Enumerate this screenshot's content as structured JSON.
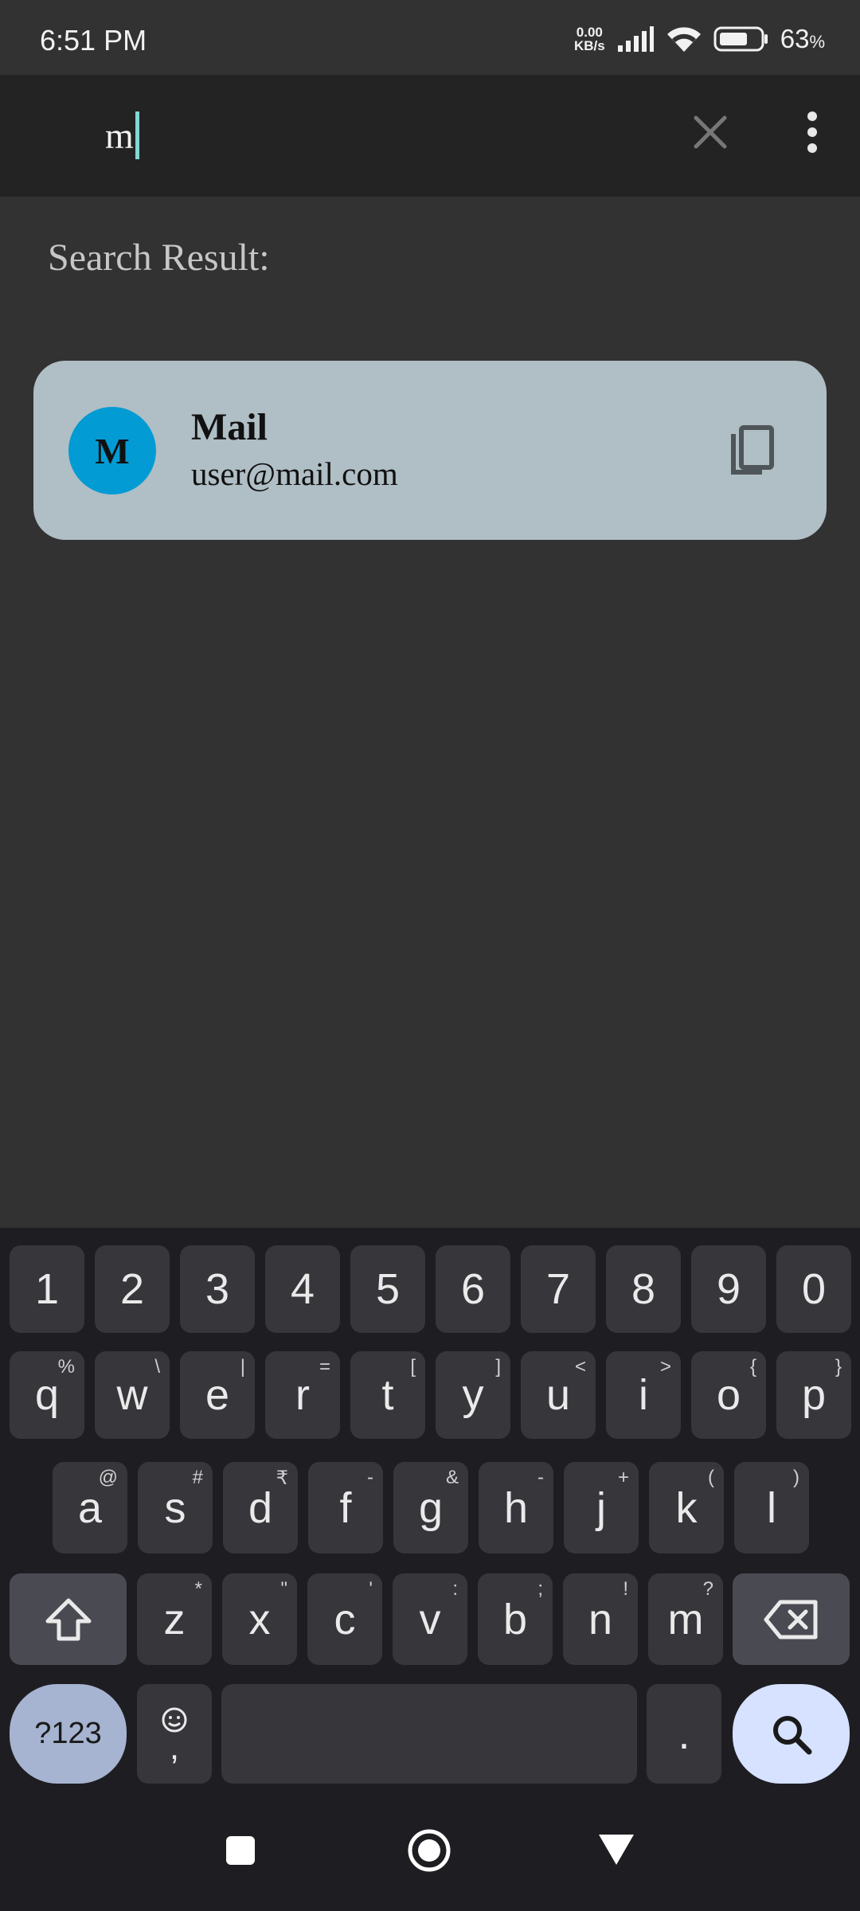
{
  "status_bar": {
    "time": "6:51 PM",
    "net_speed_value": "0.00",
    "net_speed_unit": "KB/s",
    "battery_percent": "63",
    "battery_unit": "%"
  },
  "search": {
    "query": "m"
  },
  "results": {
    "heading": "Search Result:",
    "items": [
      {
        "avatar_letter": "M",
        "title": "Mail",
        "subtitle": "user@mail.com",
        "avatar_color": "#039bd3"
      }
    ]
  },
  "keyboard": {
    "row1": [
      "1",
      "2",
      "3",
      "4",
      "5",
      "6",
      "7",
      "8",
      "9",
      "0"
    ],
    "row2": [
      {
        "k": "q",
        "s": "%"
      },
      {
        "k": "w",
        "s": "\\"
      },
      {
        "k": "e",
        "s": "|"
      },
      {
        "k": "r",
        "s": "="
      },
      {
        "k": "t",
        "s": "["
      },
      {
        "k": "y",
        "s": "]"
      },
      {
        "k": "u",
        "s": "<"
      },
      {
        "k": "i",
        "s": ">"
      },
      {
        "k": "o",
        "s": "{"
      },
      {
        "k": "p",
        "s": "}"
      }
    ],
    "row3": [
      {
        "k": "a",
        "s": "@"
      },
      {
        "k": "s",
        "s": "#"
      },
      {
        "k": "d",
        "s": "₹"
      },
      {
        "k": "f",
        "s": "-"
      },
      {
        "k": "g",
        "s": "&"
      },
      {
        "k": "h",
        "s": "-"
      },
      {
        "k": "j",
        "s": "+"
      },
      {
        "k": "k",
        "s": "("
      },
      {
        "k": "l",
        "s": ")"
      }
    ],
    "row4": [
      {
        "k": "z",
        "s": "*"
      },
      {
        "k": "x",
        "s": "\""
      },
      {
        "k": "c",
        "s": "'"
      },
      {
        "k": "v",
        "s": ":"
      },
      {
        "k": "b",
        "s": ";"
      },
      {
        "k": "n",
        "s": "!"
      },
      {
        "k": "m",
        "s": "?"
      }
    ],
    "symbols_label": "?123",
    "comma": ",",
    "period": "."
  },
  "colors": {
    "background": "#323232",
    "appbar": "#232323",
    "card": "#b0bec5",
    "caret": "#7fd9d4",
    "keyboard_bg": "#1e1e22",
    "key": "#36363b"
  }
}
